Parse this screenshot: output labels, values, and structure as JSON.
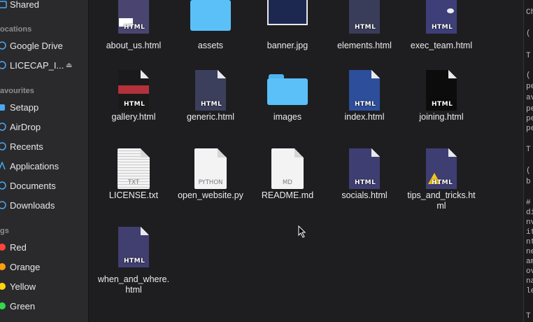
{
  "sidebar": {
    "shared": "Shared",
    "locations_head": "ocations",
    "locations": [
      "Google Drive",
      "LICECAP_I..."
    ],
    "favourites_head": "avourites",
    "favourites": [
      "Setapp",
      "AirDrop",
      "Recents",
      "Applications",
      "Documents",
      "Downloads"
    ],
    "tags_head": "gs",
    "tags": [
      {
        "label": "Red",
        "color": "#ff453a"
      },
      {
        "label": "Orange",
        "color": "#ff9f0a"
      },
      {
        "label": "Yellow",
        "color": "#ffd60a"
      },
      {
        "label": "Green",
        "color": "#32d74b"
      }
    ]
  },
  "files": [
    {
      "name": "about_us.html",
      "kind": "html"
    },
    {
      "name": "assets",
      "kind": "folder"
    },
    {
      "name": "banner.jpg",
      "kind": "image"
    },
    {
      "name": "elements.html",
      "kind": "html"
    },
    {
      "name": "exec_team.html",
      "kind": "html"
    },
    {
      "name": "gallery.html",
      "kind": "html"
    },
    {
      "name": "generic.html",
      "kind": "html"
    },
    {
      "name": "images",
      "kind": "folder"
    },
    {
      "name": "index.html",
      "kind": "html"
    },
    {
      "name": "joining.html",
      "kind": "html"
    },
    {
      "name": "LICENSE.txt",
      "kind": "txt",
      "tag": "TXT"
    },
    {
      "name": "open_website.py",
      "kind": "py",
      "tag": "PYTHON"
    },
    {
      "name": "README.md",
      "kind": "md",
      "tag": "MD"
    },
    {
      "name": "socials.html",
      "kind": "html"
    },
    {
      "name": "tips_and_tricks.ht\nml",
      "kind": "html"
    },
    {
      "name": "when_and_where.\nhtml",
      "kind": "html"
    }
  ],
  "html_badge": "HTML",
  "right_panel_chars": [
    "Ch",
    "(",
    "T",
    "(",
    "pe",
    "avi",
    "pe",
    "pe",
    "pe",
    "T",
    "(",
    "b",
    "#",
    "dir",
    "nv",
    "ite",
    "nte",
    "ne",
    "am",
    "ov",
    "na",
    "let",
    "T"
  ]
}
